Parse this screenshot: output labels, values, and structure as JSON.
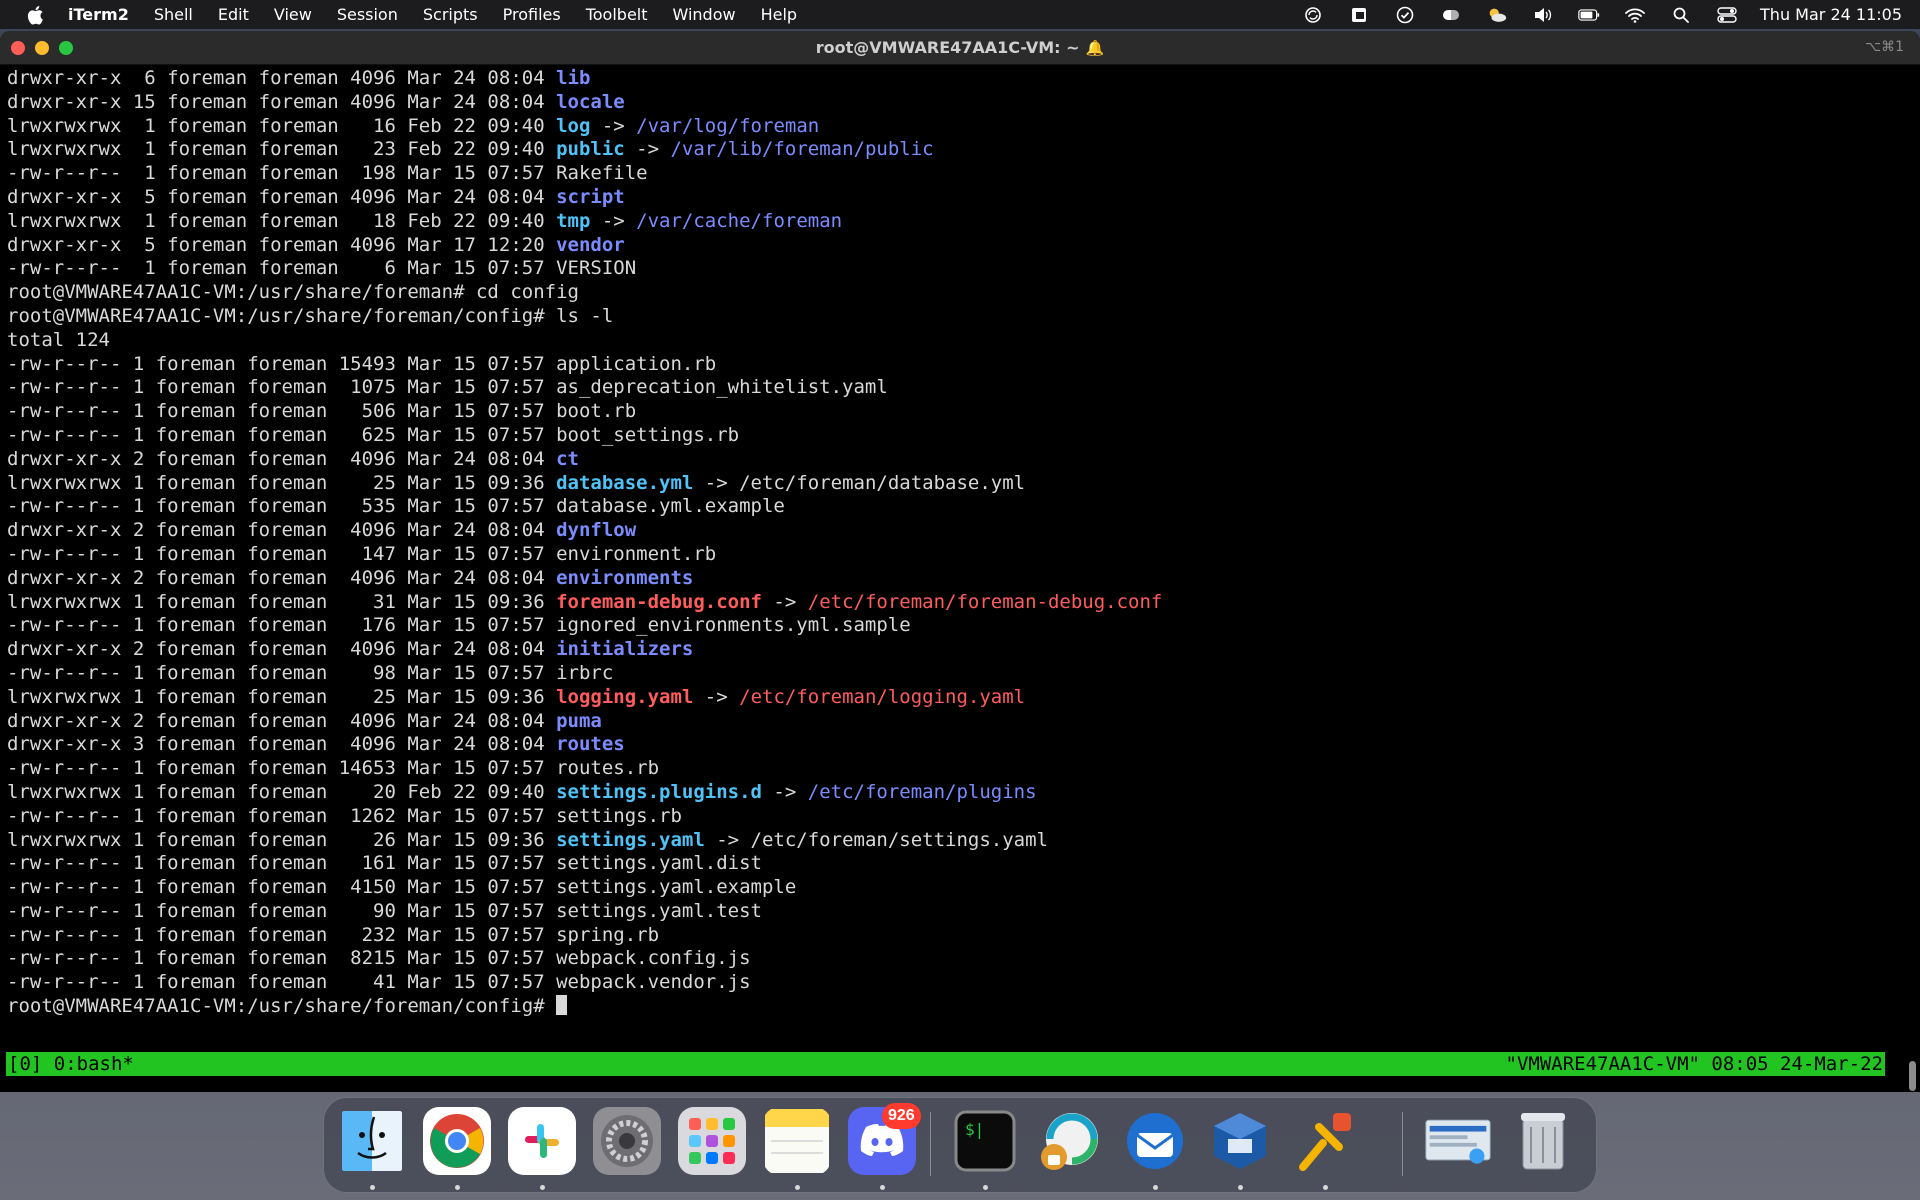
{
  "menubar": {
    "app_name": "iTerm2",
    "items": [
      "Shell",
      "Edit",
      "View",
      "Session",
      "Scripts",
      "Profiles",
      "Toolbelt",
      "Window",
      "Help"
    ],
    "clock": "Thu Mar 24  11:05",
    "status_icons": [
      "sync-icon",
      "clipboard-app-icon",
      "checkmark-circle-icon",
      "pill-icon",
      "weather-icon",
      "volume-icon",
      "battery-icon",
      "wifi-icon",
      "search-icon",
      "control-center-icon"
    ]
  },
  "window": {
    "title": "root@VMWARE47AA1C-VM: ~",
    "shortcut": "⌥⌘1"
  },
  "terminal": {
    "lines": [
      [
        {
          "t": "drwxr-xr-x  6 foreman foreman 4096 Mar 24 08:04 ",
          "c": "plain"
        },
        {
          "t": "lib",
          "c": "dir"
        }
      ],
      [
        {
          "t": "drwxr-xr-x 15 foreman foreman 4096 Mar 24 08:04 ",
          "c": "plain"
        },
        {
          "t": "locale",
          "c": "dir"
        }
      ],
      [
        {
          "t": "lrwxrwxrwx  1 foreman foreman   16 Feb 22 09:40 ",
          "c": "plain"
        },
        {
          "t": "log",
          "c": "link"
        },
        {
          "t": " -> ",
          "c": "plain"
        },
        {
          "t": "/var/log/foreman",
          "c": "target-dir"
        }
      ],
      [
        {
          "t": "lrwxrwxrwx  1 foreman foreman   23 Feb 22 09:40 ",
          "c": "plain"
        },
        {
          "t": "public",
          "c": "link"
        },
        {
          "t": " -> ",
          "c": "plain"
        },
        {
          "t": "/var/lib/foreman/public",
          "c": "target-dir"
        }
      ],
      [
        {
          "t": "-rw-r--r--  1 foreman foreman  198 Mar 15 07:57 Rakefile",
          "c": "plain"
        }
      ],
      [
        {
          "t": "drwxr-xr-x  5 foreman foreman 4096 Mar 24 08:04 ",
          "c": "plain"
        },
        {
          "t": "script",
          "c": "dir"
        }
      ],
      [
        {
          "t": "lrwxrwxrwx  1 foreman foreman   18 Feb 22 09:40 ",
          "c": "plain"
        },
        {
          "t": "tmp",
          "c": "link"
        },
        {
          "t": " -> ",
          "c": "plain"
        },
        {
          "t": "/var/cache/foreman",
          "c": "target-dir"
        }
      ],
      [
        {
          "t": "drwxr-xr-x  5 foreman foreman 4096 Mar 17 12:20 ",
          "c": "plain"
        },
        {
          "t": "vendor",
          "c": "dir"
        }
      ],
      [
        {
          "t": "-rw-r--r--  1 foreman foreman    6 Mar 15 07:57 VERSION",
          "c": "plain"
        }
      ],
      [
        {
          "t": "root@VMWARE47AA1C-VM:/usr/share/foreman# cd config",
          "c": "plain"
        }
      ],
      [
        {
          "t": "root@VMWARE47AA1C-VM:/usr/share/foreman/config# ls -l",
          "c": "plain"
        }
      ],
      [
        {
          "t": "total 124",
          "c": "plain"
        }
      ],
      [
        {
          "t": "-rw-r--r-- 1 foreman foreman 15493 Mar 15 07:57 application.rb",
          "c": "plain"
        }
      ],
      [
        {
          "t": "-rw-r--r-- 1 foreman foreman  1075 Mar 15 07:57 as_deprecation_whitelist.yaml",
          "c": "plain"
        }
      ],
      [
        {
          "t": "-rw-r--r-- 1 foreman foreman   506 Mar 15 07:57 boot.rb",
          "c": "plain"
        }
      ],
      [
        {
          "t": "-rw-r--r-- 1 foreman foreman   625 Mar 15 07:57 boot_settings.rb",
          "c": "plain"
        }
      ],
      [
        {
          "t": "drwxr-xr-x 2 foreman foreman  4096 Mar 24 08:04 ",
          "c": "plain"
        },
        {
          "t": "ct",
          "c": "dir"
        }
      ],
      [
        {
          "t": "lrwxrwxrwx 1 foreman foreman    25 Mar 15 09:36 ",
          "c": "plain"
        },
        {
          "t": "database.yml",
          "c": "link"
        },
        {
          "t": " -> /etc/foreman/database.yml",
          "c": "plain"
        }
      ],
      [
        {
          "t": "-rw-r--r-- 1 foreman foreman   535 Mar 15 07:57 database.yml.example",
          "c": "plain"
        }
      ],
      [
        {
          "t": "drwxr-xr-x 2 foreman foreman  4096 Mar 24 08:04 ",
          "c": "plain"
        },
        {
          "t": "dynflow",
          "c": "dir"
        }
      ],
      [
        {
          "t": "-rw-r--r-- 1 foreman foreman   147 Mar 15 07:57 environment.rb",
          "c": "plain"
        }
      ],
      [
        {
          "t": "drwxr-xr-x 2 foreman foreman  4096 Mar 24 08:04 ",
          "c": "plain"
        },
        {
          "t": "environments",
          "c": "dir"
        }
      ],
      [
        {
          "t": "lrwxrwxrwx 1 foreman foreman    31 Mar 15 09:36 ",
          "c": "plain"
        },
        {
          "t": "foreman-debug.conf",
          "c": "broken"
        },
        {
          "t": " -> ",
          "c": "plain"
        },
        {
          "t": "/etc/foreman/foreman-debug.conf",
          "c": "broken-target"
        }
      ],
      [
        {
          "t": "-rw-r--r-- 1 foreman foreman   176 Mar 15 07:57 ignored_environments.yml.sample",
          "c": "plain"
        }
      ],
      [
        {
          "t": "drwxr-xr-x 2 foreman foreman  4096 Mar 24 08:04 ",
          "c": "plain"
        },
        {
          "t": "initializers",
          "c": "dir"
        }
      ],
      [
        {
          "t": "-rw-r--r-- 1 foreman foreman    98 Mar 15 07:57 irbrc",
          "c": "plain"
        }
      ],
      [
        {
          "t": "lrwxrwxrwx 1 foreman foreman    25 Mar 15 09:36 ",
          "c": "plain"
        },
        {
          "t": "logging.yaml",
          "c": "broken"
        },
        {
          "t": " -> ",
          "c": "plain"
        },
        {
          "t": "/etc/foreman/logging.yaml",
          "c": "broken-target"
        }
      ],
      [
        {
          "t": "drwxr-xr-x 2 foreman foreman  4096 Mar 24 08:04 ",
          "c": "plain"
        },
        {
          "t": "puma",
          "c": "dir"
        }
      ],
      [
        {
          "t": "drwxr-xr-x 3 foreman foreman  4096 Mar 24 08:04 ",
          "c": "plain"
        },
        {
          "t": "routes",
          "c": "dir"
        }
      ],
      [
        {
          "t": "-rw-r--r-- 1 foreman foreman 14653 Mar 15 07:57 routes.rb",
          "c": "plain"
        }
      ],
      [
        {
          "t": "lrwxrwxrwx 1 foreman foreman    20 Feb 22 09:40 ",
          "c": "plain"
        },
        {
          "t": "settings.plugins.d",
          "c": "link"
        },
        {
          "t": " -> ",
          "c": "plain"
        },
        {
          "t": "/etc/foreman/plugins",
          "c": "target-dir"
        }
      ],
      [
        {
          "t": "-rw-r--r-- 1 foreman foreman  1262 Mar 15 07:57 settings.rb",
          "c": "plain"
        }
      ],
      [
        {
          "t": "lrwxrwxrwx 1 foreman foreman    26 Mar 15 09:36 ",
          "c": "plain"
        },
        {
          "t": "settings.yaml",
          "c": "link"
        },
        {
          "t": " -> /etc/foreman/settings.yaml",
          "c": "plain"
        }
      ],
      [
        {
          "t": "-rw-r--r-- 1 foreman foreman   161 Mar 15 07:57 settings.yaml.dist",
          "c": "plain"
        }
      ],
      [
        {
          "t": "-rw-r--r-- 1 foreman foreman  4150 Mar 15 07:57 settings.yaml.example",
          "c": "plain"
        }
      ],
      [
        {
          "t": "-rw-r--r-- 1 foreman foreman    90 Mar 15 07:57 settings.yaml.test",
          "c": "plain"
        }
      ],
      [
        {
          "t": "-rw-r--r-- 1 foreman foreman   232 Mar 15 07:57 spring.rb",
          "c": "plain"
        }
      ],
      [
        {
          "t": "-rw-r--r-- 1 foreman foreman  8215 Mar 15 07:57 webpack.config.js",
          "c": "plain"
        }
      ],
      [
        {
          "t": "-rw-r--r-- 1 foreman foreman    41 Mar 15 07:57 webpack.vendor.js",
          "c": "plain"
        }
      ]
    ],
    "prompt": "root@VMWARE47AA1C-VM:/usr/share/foreman/config# "
  },
  "tmux": {
    "left": "[0] 0:bash*",
    "right": "\"VMWARE47AA1C-VM\" 08:05 24-Mar-22"
  },
  "dock": {
    "apps": [
      {
        "name": "finder-icon",
        "color": "#3aa0f3"
      },
      {
        "name": "chrome-icon",
        "color": "#ffffff"
      },
      {
        "name": "slack-icon",
        "color": "#ffffff"
      },
      {
        "name": "system-preferences-icon",
        "color": "#8e8e93"
      },
      {
        "name": "launchpad-icon",
        "color": "#d9d9de"
      },
      {
        "name": "notes-icon",
        "color": "#ffd54a"
      },
      {
        "name": "discord-icon",
        "color": "#5865f2"
      },
      {
        "name": "iterm-icon",
        "color": "#2a2a2a"
      },
      {
        "name": "vpn-icon",
        "color": "#1aa3c8"
      },
      {
        "name": "thunderbird-icon",
        "color": "#1f6fd1"
      },
      {
        "name": "virtualbox-icon",
        "color": "#1c5aa8"
      },
      {
        "name": "pin-app-icon",
        "color": "#f4b400"
      },
      {
        "name": "downloads-stack-icon",
        "color": "#c9d6e3"
      },
      {
        "name": "trash-icon",
        "color": "#9aa0a6"
      }
    ],
    "discord_badge": "926"
  }
}
